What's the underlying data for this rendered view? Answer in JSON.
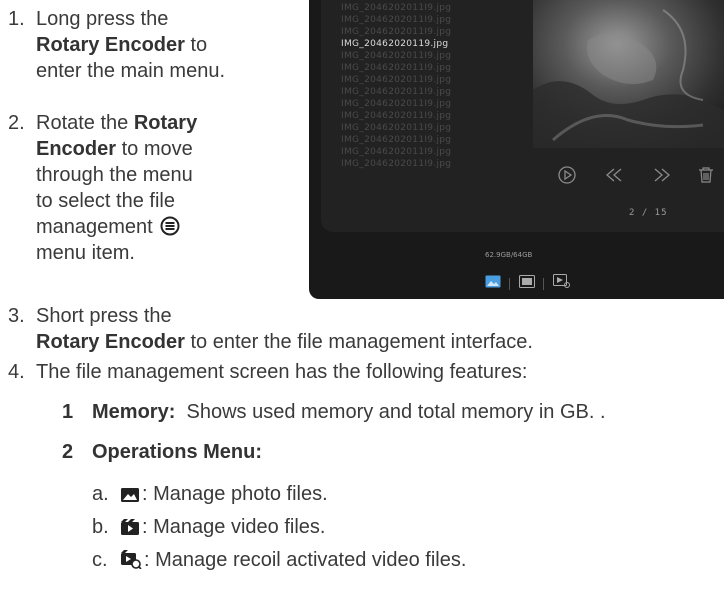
{
  "steps": {
    "s1": {
      "num": "1.",
      "pre": "Long press the",
      "bold": "Rotary Encoder",
      "post": " to enter the main menu."
    },
    "s2": {
      "num": "2.",
      "pre": "Rotate the ",
      "bold": "Rotary Encoder",
      "post_a": " to move through the menu to select the file management",
      "post_b": "menu item."
    },
    "s3": {
      "num": "3.",
      "pre": "Short press the",
      "bold": "Rotary Encoder",
      "post": " to enter the file management interface."
    },
    "s4": {
      "num": "4.",
      "text": "The file management screen has the following features:"
    }
  },
  "features": [
    {
      "num": "1",
      "label": "Memory:",
      "text": "Shows used memory and total memory in GB. ."
    },
    {
      "num": "2",
      "label": "Operations Menu:",
      "text": ""
    }
  ],
  "operations": [
    {
      "letter": "a.",
      "icon": "photo-icon",
      "text": ": Manage photo files."
    },
    {
      "letter": "b.",
      "icon": "video-icon",
      "text": ": Manage video files."
    },
    {
      "letter": "c.",
      "icon": "recoil-video-icon",
      "text": ": Manage recoil activated video files."
    }
  ],
  "device": {
    "selected_file": "IMG_20462020119.jpg",
    "counter": "2 / 15",
    "memory": "62.9GB/64GB",
    "controls": [
      "play-icon",
      "previous-icon",
      "next-icon",
      "delete-icon"
    ]
  }
}
